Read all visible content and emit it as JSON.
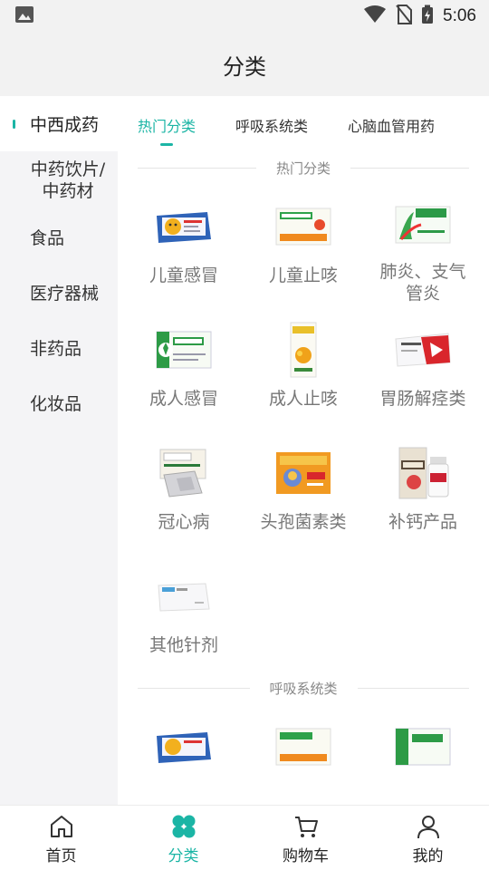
{
  "status_bar": {
    "time": "5:06"
  },
  "header": {
    "title": "分类"
  },
  "sidebar": {
    "items": [
      {
        "label": "中西成药",
        "active": true
      },
      {
        "label": "中药饮片/中药材",
        "line1": "中药饮片/",
        "line2": "中药材"
      },
      {
        "label": "食品"
      },
      {
        "label": "医疗器械"
      },
      {
        "label": "非药品"
      },
      {
        "label": "化妆品"
      }
    ]
  },
  "tabs": [
    {
      "label": "热门分类",
      "active": true
    },
    {
      "label": "呼吸系统类"
    },
    {
      "label": "心脑血管用药"
    }
  ],
  "sections": [
    {
      "title": "热门分类",
      "items": [
        {
          "label": "儿童感冒",
          "icon": "kids-cold-medicine-box"
        },
        {
          "label": "儿童止咳",
          "icon": "kids-cough-medicine-box"
        },
        {
          "label": "肺炎、支气管炎",
          "line1": "肺炎、支气",
          "line2": "管炎",
          "icon": "lung-medicine-box"
        },
        {
          "label": "成人感冒",
          "icon": "adult-cold-medicine-box"
        },
        {
          "label": "成人止咳",
          "icon": "cough-syrup-bottle"
        },
        {
          "label": "胃肠解痉类",
          "icon": "stomach-medicine-box"
        },
        {
          "label": "冠心病",
          "icon": "heart-granules-pack"
        },
        {
          "label": "头孢菌素类",
          "icon": "cephalosporin-box"
        },
        {
          "label": "补钙产品",
          "icon": "calcium-bottles"
        },
        {
          "label": "其他针剂",
          "icon": "injection-box"
        }
      ]
    },
    {
      "title": "呼吸系统类",
      "items": [
        {
          "label": "",
          "icon": "kids-cold-medicine-box"
        },
        {
          "label": "",
          "icon": "kids-cough-medicine-box"
        },
        {
          "label": "",
          "icon": "adult-cold-medicine-box"
        }
      ]
    }
  ],
  "tabbar": [
    {
      "label": "首页",
      "icon": "home-icon"
    },
    {
      "label": "分类",
      "icon": "category-icon",
      "active": true
    },
    {
      "label": "购物车",
      "icon": "cart-icon"
    },
    {
      "label": "我的",
      "icon": "profile-icon"
    }
  ],
  "colors": {
    "accent": "#1bb5a5",
    "text": "#333333",
    "muted": "#777777"
  }
}
